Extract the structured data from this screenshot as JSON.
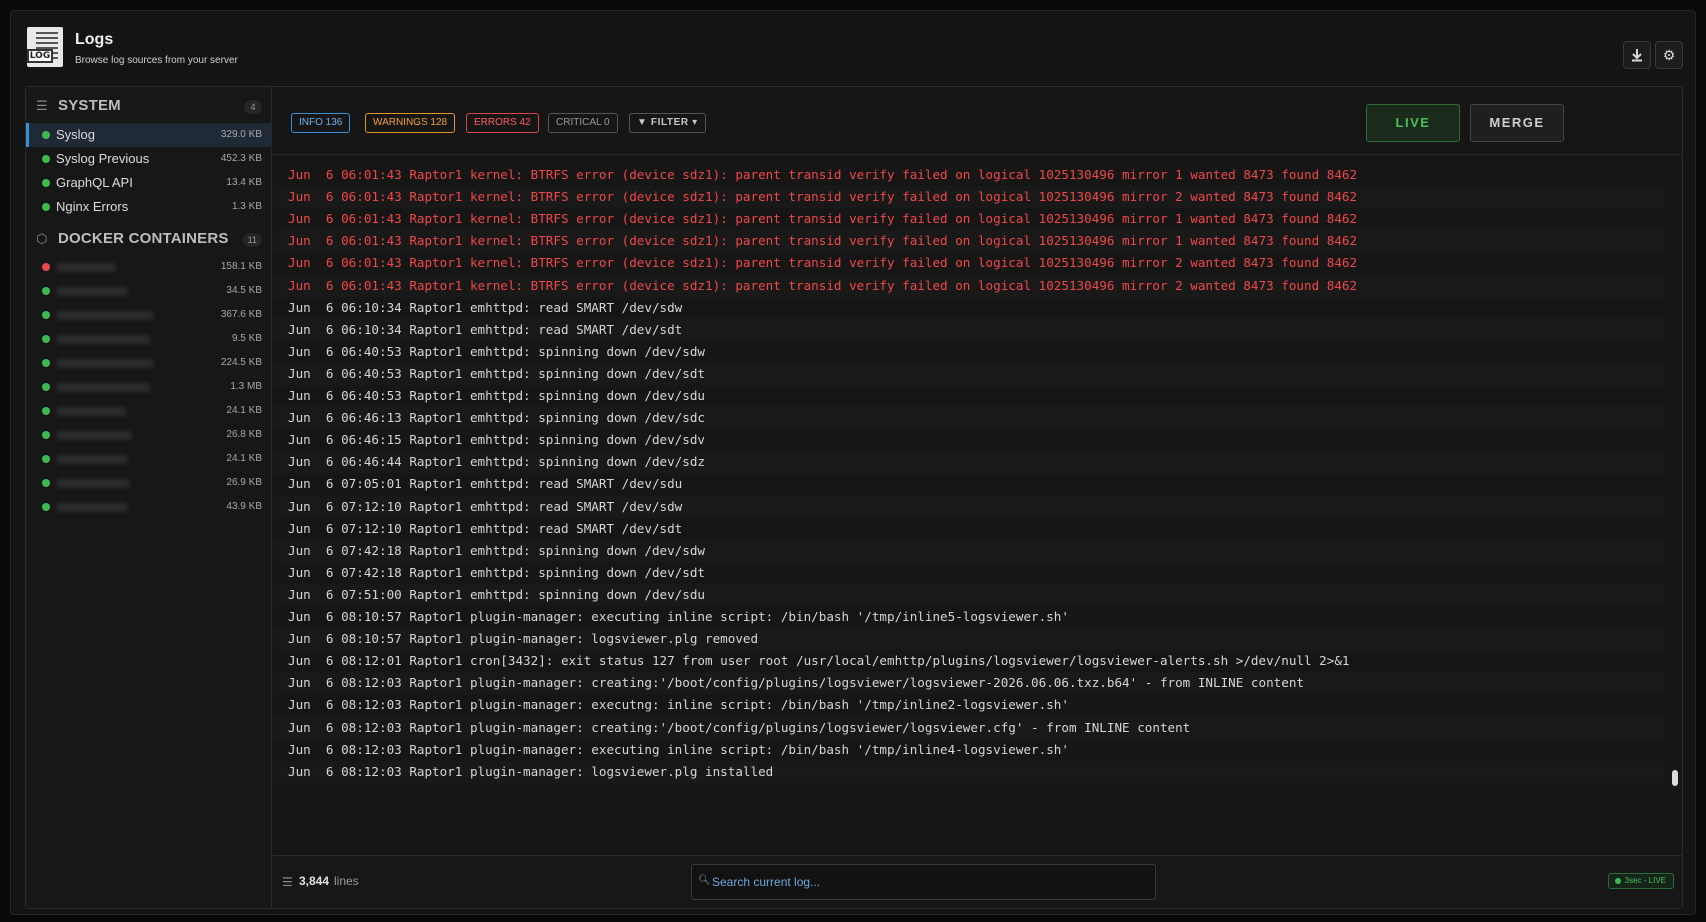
{
  "header": {
    "title": "Logs",
    "subtitle": "Browse log sources from your server",
    "logo_text": "LOG",
    "download_icon": "download-icon",
    "settings_icon": "gear-icon"
  },
  "sidebar": {
    "system": {
      "title": "SYSTEM",
      "count": "4",
      "items": [
        {
          "label": "Syslog",
          "size": "329.0 KB",
          "status": "green",
          "active": true
        },
        {
          "label": "Syslog Previous",
          "size": "452.3 KB",
          "status": "green"
        },
        {
          "label": "GraphQL API",
          "size": "13.4 KB",
          "status": "green"
        },
        {
          "label": "Nginx Errors",
          "size": "1.3 KB",
          "status": "green"
        }
      ]
    },
    "docker": {
      "title": "DOCKER CONTAINERS",
      "count": "11",
      "items": [
        {
          "size": "158.1 KB",
          "status": "red"
        },
        {
          "size": "34.5 KB",
          "status": "green"
        },
        {
          "size": "367.6 KB",
          "status": "green"
        },
        {
          "size": "9.5 KB",
          "status": "green"
        },
        {
          "size": "224.5 KB",
          "status": "green"
        },
        {
          "size": "1.3 MB",
          "status": "green"
        },
        {
          "size": "24.1 KB",
          "status": "green"
        },
        {
          "size": "26.8 KB",
          "status": "green"
        },
        {
          "size": "24.1 KB",
          "status": "green"
        },
        {
          "size": "26.9 KB",
          "status": "green"
        },
        {
          "size": "43.9 KB",
          "status": "green"
        }
      ]
    }
  },
  "toolbar": {
    "info": "INFO 136",
    "warnings": "WARNINGS 128",
    "errors": "ERRORS 42",
    "critical": "CRITICAL 0",
    "filter": "▼ FILTER ▾",
    "live": "LIVE",
    "merge": "MERGE"
  },
  "log_lines": [
    {
      "text": "Jun  6 06:01:43 Raptor1 kernel: BTRFS error (device sdz1): parent transid verify failed on logical 1025130496 mirror 1 wanted 8473 found 8462",
      "level": "error"
    },
    {
      "text": "Jun  6 06:01:43 Raptor1 kernel: BTRFS error (device sdz1): parent transid verify failed on logical 1025130496 mirror 2 wanted 8473 found 8462",
      "level": "error"
    },
    {
      "text": "Jun  6 06:01:43 Raptor1 kernel: BTRFS error (device sdz1): parent transid verify failed on logical 1025130496 mirror 1 wanted 8473 found 8462",
      "level": "error"
    },
    {
      "text": "Jun  6 06:01:43 Raptor1 kernel: BTRFS error (device sdz1): parent transid verify failed on logical 1025130496 mirror 1 wanted 8473 found 8462",
      "level": "error"
    },
    {
      "text": "Jun  6 06:01:43 Raptor1 kernel: BTRFS error (device sdz1): parent transid verify failed on logical 1025130496 mirror 2 wanted 8473 found 8462",
      "level": "error"
    },
    {
      "text": "Jun  6 06:01:43 Raptor1 kernel: BTRFS error (device sdz1): parent transid verify failed on logical 1025130496 mirror 2 wanted 8473 found 8462",
      "level": "error"
    },
    {
      "text": "Jun  6 06:10:34 Raptor1 emhttpd: read SMART /dev/sdw",
      "level": "info"
    },
    {
      "text": "Jun  6 06:10:34 Raptor1 emhttpd: read SMART /dev/sdt",
      "level": "info"
    },
    {
      "text": "Jun  6 06:40:53 Raptor1 emhttpd: spinning down /dev/sdw",
      "level": "info"
    },
    {
      "text": "Jun  6 06:40:53 Raptor1 emhttpd: spinning down /dev/sdt",
      "level": "info"
    },
    {
      "text": "Jun  6 06:40:53 Raptor1 emhttpd: spinning down /dev/sdu",
      "level": "info"
    },
    {
      "text": "Jun  6 06:46:13 Raptor1 emhttpd: spinning down /dev/sdc",
      "level": "info"
    },
    {
      "text": "Jun  6 06:46:15 Raptor1 emhttpd: spinning down /dev/sdv",
      "level": "info"
    },
    {
      "text": "Jun  6 06:46:44 Raptor1 emhttpd: spinning down /dev/sdz",
      "level": "info"
    },
    {
      "text": "Jun  6 07:05:01 Raptor1 emhttpd: read SMART /dev/sdu",
      "level": "info"
    },
    {
      "text": "Jun  6 07:12:10 Raptor1 emhttpd: read SMART /dev/sdw",
      "level": "info"
    },
    {
      "text": "Jun  6 07:12:10 Raptor1 emhttpd: read SMART /dev/sdt",
      "level": "info"
    },
    {
      "text": "Jun  6 07:42:18 Raptor1 emhttpd: spinning down /dev/sdw",
      "level": "info"
    },
    {
      "text": "Jun  6 07:42:18 Raptor1 emhttpd: spinning down /dev/sdt",
      "level": "info"
    },
    {
      "text": "Jun  6 07:51:00 Raptor1 emhttpd: spinning down /dev/sdu",
      "level": "info"
    },
    {
      "text": "Jun  6 08:10:57 Raptor1 plugin-manager: executing inline script: /bin/bash '/tmp/inline5-logsviewer.sh'",
      "level": "info"
    },
    {
      "text": "Jun  6 08:10:57 Raptor1 plugin-manager: logsviewer.plg removed",
      "level": "info"
    },
    {
      "text": "Jun  6 08:12:01 Raptor1 cron[3432]: exit status 127 from user root /usr/local/emhttp/plugins/logsviewer/logsviewer-alerts.sh >/dev/null 2>&1",
      "level": "info"
    },
    {
      "text": "Jun  6 08:12:03 Raptor1 plugin-manager: creating:'/boot/config/plugins/logsviewer/logsviewer-2026.06.06.txz.b64' - from INLINE content",
      "level": "info"
    },
    {
      "text": "Jun  6 08:12:03 Raptor1 plugin-manager: executng: inline script: /bin/bash '/tmp/inline2-logsviewer.sh'",
      "level": "info"
    },
    {
      "text": "Jun  6 08:12:03 Raptor1 plugin-manager: creating:'/boot/config/plugins/logsviewer/logsviewer.cfg' - from INLINE content",
      "level": "info"
    },
    {
      "text": "Jun  6 08:12:03 Raptor1 plugin-manager: executing inline script: /bin/bash '/tmp/inline4-logsviewer.sh'",
      "level": "info"
    },
    {
      "text": "Jun  6 08:12:03 Raptor1 plugin-manager: logsviewer.plg installed",
      "level": "info"
    }
  ],
  "footer": {
    "line_count": "3,844",
    "lines_label": "lines",
    "search_placeholder": "Search current log...",
    "status": "3sec - LIVE"
  },
  "colors": {
    "accent": "#3b8fd6",
    "error": "#f04848",
    "warning": "#f0a040",
    "live": "#4bbd5a"
  }
}
